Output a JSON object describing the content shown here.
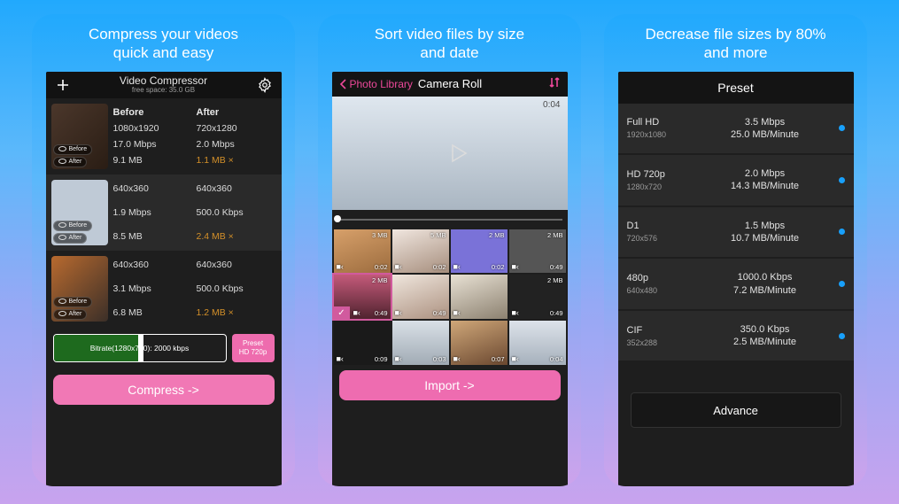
{
  "panels": [
    {
      "caption": "Compress your videos\nquick and easy"
    },
    {
      "caption": "Sort video files by size\nand date"
    },
    {
      "caption": "Decrease file sizes by 80%\nand more"
    }
  ],
  "phone1": {
    "title": "Video Compressor",
    "free_space": "free space: 35.0 GB",
    "col_before": "Before",
    "col_after": "After",
    "badge_before": "Before",
    "badge_after": "After",
    "rows": [
      {
        "before": {
          "res": "1080x1920",
          "bitrate": "17.0 Mbps",
          "size": "9.1 MB"
        },
        "after": {
          "res": "720x1280",
          "bitrate": "2.0 Mbps",
          "size": "1.1 MB ×"
        }
      },
      {
        "before": {
          "res": "640x360",
          "bitrate": "1.9 Mbps",
          "size": "8.5 MB"
        },
        "after": {
          "res": "640x360",
          "bitrate": "500.0 Kbps",
          "size": "2.4 MB ×"
        }
      },
      {
        "before": {
          "res": "640x360",
          "bitrate": "3.1 Mbps",
          "size": "6.8 MB"
        },
        "after": {
          "res": "640x360",
          "bitrate": "500.0 Kbps",
          "size": "1.2 MB ×"
        }
      }
    ],
    "slider_label": "Bitrate(1280x720): 2000 kbps",
    "preset_label": "Preset",
    "preset_sub": "HD 720p",
    "compress": "Compress ->"
  },
  "phone2": {
    "back": "Photo Library",
    "title": "Camera Roll",
    "preview_duration": "0:04",
    "cells": [
      {
        "size": "3 MB",
        "dur": "0:02"
      },
      {
        "size": "5 MB",
        "dur": "0:02"
      },
      {
        "size": "2 MB",
        "dur": "0:02"
      },
      {
        "size": "2 MB",
        "dur": "0:49"
      },
      {
        "size": "2 MB",
        "dur": "0:49",
        "selected": true
      },
      {
        "size": "",
        "dur": "0:49"
      },
      {
        "size": "",
        "dur": ""
      },
      {
        "size": "2 MB",
        "dur": "0:49"
      },
      {
        "size": "",
        "dur": "0:09"
      },
      {
        "size": "",
        "dur": "0:03"
      },
      {
        "size": "",
        "dur": "0:07"
      },
      {
        "size": "",
        "dur": "0:04"
      }
    ],
    "import": "Import ->"
  },
  "phone3": {
    "title": "Preset",
    "rows": [
      {
        "name": "Full HD",
        "dim": "1920x1080",
        "bitrate": "3.5 Mbps",
        "per": "25.0 MB/Minute"
      },
      {
        "name": "HD 720p",
        "dim": "1280x720",
        "bitrate": "2.0 Mbps",
        "per": "14.3 MB/Minute"
      },
      {
        "name": "D1",
        "dim": "720x576",
        "bitrate": "1.5 Mbps",
        "per": "10.7 MB/Minute"
      },
      {
        "name": "480p",
        "dim": "640x480",
        "bitrate": "1000.0 Kbps",
        "per": "7.2 MB/Minute"
      },
      {
        "name": "CIF",
        "dim": "352x288",
        "bitrate": "350.0 Kbps",
        "per": "2.5 MB/Minute"
      }
    ],
    "advance": "Advance"
  }
}
